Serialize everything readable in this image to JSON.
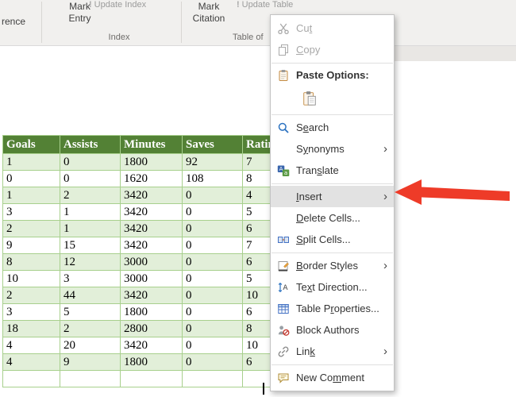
{
  "ribbon": {
    "cross_reference_partial": "rence",
    "mark_entry": {
      "line1": "Mark",
      "line2": "Entry"
    },
    "update_glyph": "!",
    "update_index": "Update Index",
    "index_group": "Index",
    "mark_citation": {
      "line1": "Mark",
      "line2": "Citation"
    },
    "update_table": "Update Table",
    "table_of_group": "Table of"
  },
  "table": {
    "headers": [
      "Goals",
      "Assists",
      "Minutes",
      "Saves",
      "Rating"
    ],
    "rows": [
      [
        "1",
        "0",
        "1800",
        "92",
        "7"
      ],
      [
        "0",
        "0",
        "1620",
        "108",
        "8"
      ],
      [
        "1",
        "2",
        "3420",
        "0",
        "4"
      ],
      [
        "3",
        "1",
        "3420",
        "0",
        "5"
      ],
      [
        "2",
        "1",
        "3420",
        "0",
        "6"
      ],
      [
        "9",
        "15",
        "3420",
        "0",
        "7"
      ],
      [
        "8",
        "12",
        "3000",
        "0",
        "6"
      ],
      [
        "10",
        "3",
        "3000",
        "0",
        "5"
      ],
      [
        "2",
        "44",
        "3420",
        "0",
        "10"
      ],
      [
        "3",
        "5",
        "1800",
        "0",
        "6"
      ],
      [
        "18",
        "2",
        "2800",
        "0",
        "8"
      ],
      [
        "4",
        "20",
        "3420",
        "0",
        "10"
      ],
      [
        "4",
        "9",
        "1800",
        "0",
        "6"
      ]
    ],
    "colors": {
      "header_bg": "#538135",
      "band_bg": "#e2efd9",
      "border": "#a8d08d",
      "header_text": "#ffffff"
    }
  },
  "menu": {
    "highlight_bg": "#e2e2e2",
    "submenu_chevron": "›",
    "items": [
      {
        "type": "item",
        "name": "cut",
        "label": "Cut",
        "underline": 2,
        "icon": "scissors-icon",
        "disabled": true
      },
      {
        "type": "item",
        "name": "copy",
        "label": "Copy",
        "underline": 0,
        "icon": "copy-icon",
        "disabled": true
      },
      {
        "type": "separator"
      },
      {
        "type": "label",
        "name": "paste-options",
        "label": "Paste Options:",
        "icon": "clipboard-icon"
      },
      {
        "type": "paste-button",
        "name": "paste-keep-source-formatting",
        "icon": "paste-icon"
      },
      {
        "type": "separator"
      },
      {
        "type": "item",
        "name": "search",
        "label": "Search",
        "underline": 1,
        "icon": "search-icon"
      },
      {
        "type": "item",
        "name": "synonyms",
        "label": "Synonyms",
        "underline": 1,
        "submenu": true
      },
      {
        "type": "item",
        "name": "translate",
        "label": "Translate",
        "underline": 4,
        "icon": "translate-icon"
      },
      {
        "type": "separator"
      },
      {
        "type": "item",
        "name": "insert",
        "label": "Insert",
        "underline": 0,
        "submenu": true,
        "highlighted": true
      },
      {
        "type": "item",
        "name": "delete-cells",
        "label": "Delete Cells...",
        "underline": 0
      },
      {
        "type": "item",
        "name": "split-cells",
        "label": "Split Cells...",
        "underline": 0,
        "icon": "split-cells-icon"
      },
      {
        "type": "separator"
      },
      {
        "type": "item",
        "name": "border-styles",
        "label": "Border Styles",
        "underline": 0,
        "icon": "border-styles-icon",
        "submenu": true
      },
      {
        "type": "item",
        "name": "text-direction",
        "label": "Text Direction...",
        "underline": 2,
        "icon": "text-direction-icon"
      },
      {
        "type": "item",
        "name": "table-properties",
        "label": "Table Properties...",
        "underline": 7,
        "icon": "table-properties-icon"
      },
      {
        "type": "item",
        "name": "block-authors",
        "label": "Block Authors",
        "icon": "block-authors-icon"
      },
      {
        "type": "item",
        "name": "link",
        "label": "Link",
        "underline": 3,
        "icon": "link-icon",
        "submenu": true
      },
      {
        "type": "separator"
      },
      {
        "type": "item",
        "name": "new-comment",
        "label": "New Comment",
        "underline": 6,
        "icon": "comment-icon"
      }
    ]
  },
  "annotations": {
    "arrow_color": "#ee3b28"
  }
}
